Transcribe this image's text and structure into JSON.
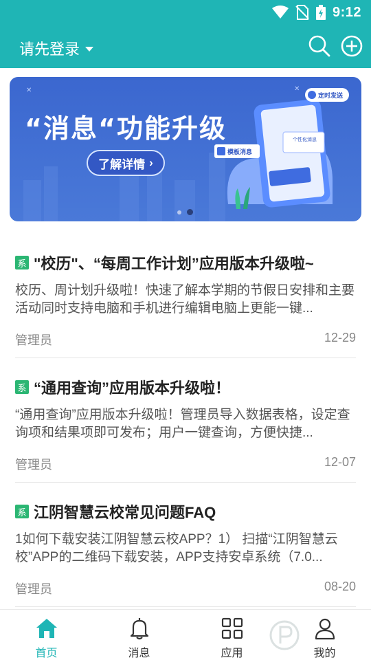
{
  "status_bar": {
    "time": "9:12"
  },
  "app_bar": {
    "login_label": "请先登录",
    "icons": [
      "search-icon",
      "add-circle-icon"
    ]
  },
  "banner": {
    "title": "“消息“功能升级",
    "button_label": "了解详情",
    "tag_scheduled": "定时发送",
    "tag_template": "模板消息",
    "tag_personal": "个性化消息",
    "page_count": 2,
    "active_page": 2
  },
  "news": [
    {
      "tag": "系",
      "title": "\"校历\"、“每周工作计划”应用版本升级啦~",
      "summary": "校历、周计划升级啦！快速了解本学期的节假日安排和主要活动同时支持电脑和手机进行编辑电脑上更能一键...",
      "author": "管理员",
      "date": "12-29"
    },
    {
      "tag": "系",
      "title": "“通用查询”应用版本升级啦！",
      "summary": "“通用查询”应用版本升级啦！管理员导入数据表格，设定查询项和结果项即可发布；用户一键查询，方便快捷...",
      "author": "管理员",
      "date": "12-07"
    },
    {
      "tag": "系",
      "title": "江阴智慧云校常见问题FAQ",
      "summary": "1如何下载安装江阴智慧云校APP？1） 扫描“江阴智慧云校”APP的二维码下载安装，APP支持安卓系统（7.0...",
      "author": "管理员",
      "date": "08-20"
    }
  ],
  "bottom_nav": {
    "items": [
      {
        "label": "首页",
        "icon": "home-icon",
        "active": true
      },
      {
        "label": "消息",
        "icon": "bell-icon",
        "active": false
      },
      {
        "label": "应用",
        "icon": "grid-icon",
        "active": false
      },
      {
        "label": "我的",
        "icon": "user-icon",
        "active": false
      }
    ]
  },
  "colors": {
    "accent": "#1fb5b5",
    "tag": "#2bb673",
    "banner": "#3b67cf"
  }
}
